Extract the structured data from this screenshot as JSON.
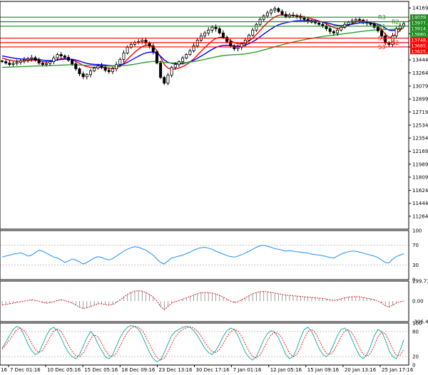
{
  "chart_data": {
    "type": "candlestick",
    "title": "",
    "main": {
      "ylim": [
        11084,
        14260
      ],
      "y_ticks": [
        "14169.0",
        "13989.0",
        "13809.0",
        "13624.0",
        "13444.0",
        "13264.0",
        "13079.0",
        "12899.0",
        "12719.0",
        "12534.0",
        "12354.0",
        "12169.0",
        "11989.0",
        "11809.0",
        "11624.0",
        "11444.0",
        "11264.0"
      ],
      "x_labels": [
        "7 Dec 01:16",
        "10 Dec 05:16",
        "15 Dec 05:16",
        "18 Dec 09:16",
        "23 Dec 13:16",
        "30 Dec 17:16",
        "7 Jan 01:16",
        "12 Jan 05:16",
        "15 Jan 09:16",
        "20 Jan 13:16",
        "25 Jan 17:16"
      ],
      "x_label_left_fragment": "16",
      "candles_close": [
        13420,
        13400,
        13380,
        13395,
        13410,
        13430,
        13445,
        13460,
        13475,
        13440,
        13400,
        13380,
        13395,
        13420,
        13470,
        13520,
        13500,
        13480,
        13440,
        13390,
        13320,
        13250,
        13210,
        13240,
        13290,
        13330,
        13360,
        13340,
        13300,
        13280,
        13320,
        13380,
        13450,
        13540,
        13620,
        13660,
        13690,
        13700,
        13720,
        13680,
        13640,
        13560,
        13400,
        13200,
        13120,
        13230,
        13340,
        13380,
        13420,
        13470,
        13520,
        13570,
        13640,
        13720,
        13780,
        13820,
        13860,
        13900,
        13880,
        13820,
        13760,
        13700,
        13640,
        13600,
        13620,
        13670,
        13720,
        13790,
        13860,
        13940,
        14010,
        14060,
        14100,
        14140,
        14160,
        14120,
        14080,
        14050,
        14070,
        14060,
        14050,
        14030,
        14010,
        13990,
        13970,
        13960,
        13940,
        13920,
        13880,
        13840,
        13820,
        13860,
        13900,
        13940,
        13970,
        13990,
        14010,
        14000,
        13980,
        13960,
        13940,
        13900,
        13850,
        13780,
        13680,
        13660,
        13780,
        13880,
        13920,
        13950
      ],
      "series": [
        {
          "name": "",
          "color": "#ff0000",
          "values": [
            13470,
            13455,
            13440,
            13430,
            13425,
            13425,
            13428,
            13433,
            13440,
            13440,
            13432,
            13420,
            13415,
            13417,
            13430,
            13448,
            13460,
            13465,
            13460,
            13446,
            13425,
            13397,
            13368,
            13350,
            13340,
            13338,
            13340,
            13340,
            13335,
            13328,
            13325,
            13334,
            13357,
            13397,
            13452,
            13505,
            13552,
            13594,
            13630,
            13650,
            13650,
            13628,
            13573,
            13479,
            13380,
            13328,
            13316,
            13319,
            13331,
            13351,
            13379,
            13413,
            13458,
            13511,
            13565,
            13616,
            13664,
            13710,
            13745,
            13760,
            13758,
            13741,
            13714,
            13684,
            13668,
            13668,
            13681,
            13708,
            13747,
            13798,
            13856,
            13912,
            13963,
            14008,
            14044,
            14066,
            14072,
            14066,
            14066,
            14064,
            14061,
            14055,
            14045,
            14032,
            14018,
            14003,
            13987,
            13969,
            13947,
            13921,
            13896,
            13885,
            13888,
            13904,
            13926,
            13951,
            13977,
            13988,
            13986,
            13977,
            13963,
            13941,
            13911,
            13867,
            13804,
            13759,
            13770,
            13812,
            13857,
            13899
          ]
        },
        {
          "name": "",
          "color": "#0000ff",
          "values": [
            13500,
            13490,
            13480,
            13470,
            13463,
            13458,
            13455,
            13454,
            13455,
            13455,
            13450,
            13442,
            13436,
            13433,
            13436,
            13444,
            13451,
            13456,
            13457,
            13453,
            13443,
            13428,
            13410,
            13396,
            13387,
            13382,
            13380,
            13377,
            13372,
            13366,
            13363,
            13364,
            13371,
            13386,
            13411,
            13439,
            13468,
            13496,
            13522,
            13541,
            13552,
            13553,
            13537,
            13496,
            13443,
            13411,
            13397,
            13391,
            13390,
            13394,
            13404,
            13419,
            13440,
            13467,
            13497,
            13528,
            13560,
            13591,
            13618,
            13636,
            13646,
            13649,
            13646,
            13639,
            13636,
            13640,
            13651,
            13670,
            13696,
            13729,
            13767,
            13805,
            13841,
            13876,
            13908,
            13933,
            13950,
            13962,
            13974,
            13983,
            13990,
            13993,
            13994,
            13993,
            13990,
            13986,
            13981,
            13974,
            13963,
            13949,
            13935,
            13927,
            13924,
            13926,
            13933,
            13942,
            13953,
            13960,
            13963,
            13963,
            13960,
            13953,
            13942,
            13922,
            13888,
            13859,
            13853,
            13863,
            13878,
            13894
          ]
        },
        {
          "name": "",
          "color": "#2ca02c",
          "values": [
            13340,
            13342,
            13344,
            13346,
            13348,
            13350,
            13352,
            13355,
            13358,
            13360,
            13361,
            13362,
            13363,
            13364,
            13366,
            13369,
            13372,
            13374,
            13376,
            13377,
            13376,
            13374,
            13371,
            13368,
            13366,
            13364,
            13363,
            13362,
            13360,
            13359,
            13358,
            13358,
            13360,
            13364,
            13370,
            13377,
            13385,
            13394,
            13403,
            13411,
            13418,
            13423,
            13423,
            13418,
            13409,
            13404,
            13402,
            13401,
            13402,
            13404,
            13408,
            13414,
            13421,
            13430,
            13441,
            13452,
            13464,
            13476,
            13487,
            13496,
            13504,
            13510,
            13514,
            13517,
            13520,
            13524,
            13529,
            13536,
            13545,
            13556,
            13569,
            13583,
            13597,
            13612,
            13627,
            13641,
            13655,
            13668,
            13681,
            13693,
            13705,
            13716,
            13726,
            13736,
            13745,
            13754,
            13763,
            13771,
            13778,
            13785,
            13791,
            13797,
            13803,
            13810,
            13817,
            13824,
            13831,
            13838,
            13844,
            13850,
            13856,
            13861,
            13865,
            13868,
            13868,
            13868,
            13871,
            13876,
            13882,
            13888
          ]
        }
      ],
      "levels": [
        {
          "label": "R3",
          "value": 14039.6,
          "color": "#1a8a1a"
        },
        {
          "label": "R2",
          "value": 13977.2,
          "color": "#1a8a1a"
        },
        {
          "label": "R1",
          "value": 13914.7,
          "color": "#1a8a1a"
        },
        {
          "label": "S1",
          "value": 13748.3,
          "color": "#ff0000"
        },
        {
          "label": "S2",
          "value": 13685.8,
          "color": "#ff0000"
        },
        {
          "label": "S3",
          "value": 13625.4,
          "color": "#ff0000"
        }
      ],
      "price_badges": [
        {
          "text": "14039.6",
          "value": 14039.6,
          "color": "#1a8a1a"
        },
        {
          "text": "13977.2",
          "value": 13977.2,
          "color": "#1a8a1a"
        },
        {
          "text": "13914.7",
          "value": 13914.7,
          "color": "#1a8a1a"
        },
        {
          "text": "13880.4",
          "value": 13880.4,
          "color": "#1a8a1a"
        },
        {
          "text": "13748.3",
          "value": 13748.3,
          "color": "#ff0000"
        },
        {
          "text": "13685.8",
          "value": 13685.8,
          "color": "#ff0000"
        },
        {
          "text": "13625.4",
          "value": 13625.4,
          "color": "#ff0000"
        }
      ]
    },
    "rsi": {
      "ylim": [
        0,
        100
      ],
      "y_ticks": [
        "100",
        "70",
        "30",
        "0"
      ],
      "color": "#1e90ff",
      "values": [
        46,
        48,
        50,
        52,
        53,
        55,
        52,
        48,
        50,
        55,
        60,
        58,
        54,
        50,
        46,
        44,
        40,
        35,
        38,
        42,
        40,
        36,
        32,
        35,
        40,
        44,
        47,
        45,
        42,
        40,
        43,
        48,
        53,
        58,
        62,
        65,
        67,
        66,
        63,
        60,
        55,
        50,
        42,
        35,
        32,
        38,
        44,
        46,
        48,
        50,
        53,
        56,
        60,
        63,
        65,
        66,
        64,
        62,
        58,
        55,
        52,
        49,
        47,
        46,
        48,
        51,
        54,
        58,
        62,
        66,
        69,
        70,
        68,
        66,
        63,
        62,
        60,
        58,
        59,
        58,
        57,
        56,
        55,
        54,
        52,
        51,
        50,
        49,
        47,
        45,
        44,
        48,
        52,
        55,
        57,
        58,
        58,
        56,
        54,
        52,
        50,
        48,
        45,
        40,
        35,
        34,
        42,
        47,
        50,
        53
      ]
    },
    "cci": {
      "ylim": [
        -306.45,
        299.71
      ],
      "y_ticks": [
        "299.71",
        "0.00",
        "-306.45"
      ],
      "line_color": "#cc0000",
      "hist_color": "#888888",
      "values": [
        -60,
        -50,
        -40,
        -30,
        -20,
        -10,
        0,
        10,
        20,
        10,
        0,
        -20,
        -30,
        -25,
        -10,
        10,
        20,
        10,
        -10,
        -30,
        -60,
        -90,
        -110,
        -100,
        -80,
        -60,
        -40,
        -40,
        -50,
        -60,
        -50,
        -20,
        20,
        60,
        100,
        130,
        150,
        155,
        150,
        130,
        100,
        60,
        0,
        -80,
        -130,
        -80,
        -30,
        -10,
        10,
        30,
        50,
        70,
        90,
        110,
        125,
        130,
        128,
        120,
        105,
        85,
        60,
        30,
        0,
        -20,
        -10,
        20,
        50,
        80,
        110,
        130,
        140,
        145,
        140,
        130,
        120,
        110,
        100,
        90,
        85,
        80,
        75,
        70,
        65,
        60,
        55,
        50,
        45,
        40,
        30,
        20,
        10,
        20,
        35,
        50,
        60,
        65,
        68,
        65,
        55,
        45,
        35,
        20,
        0,
        -30,
        -70,
        -90,
        -60,
        -30,
        -10,
        0
      ]
    },
    "stochastic": {
      "ylim": [
        0,
        100
      ],
      "y_ticks": [
        "100",
        "80",
        "20",
        "0"
      ],
      "k_color": "#20b2aa",
      "d_color": "#ff0000",
      "k_values": [
        40,
        55,
        70,
        85,
        92,
        88,
        70,
        50,
        35,
        25,
        30,
        50,
        70,
        85,
        90,
        82,
        65,
        45,
        30,
        20,
        15,
        25,
        45,
        65,
        80,
        70,
        50,
        35,
        20,
        15,
        25,
        45,
        65,
        80,
        90,
        94,
        92,
        85,
        70,
        50,
        30,
        15,
        8,
        12,
        30,
        50,
        70,
        80,
        85,
        90,
        92,
        90,
        82,
        70,
        55,
        40,
        30,
        25,
        35,
        50,
        68,
        82,
        88,
        85,
        70,
        50,
        30,
        18,
        12,
        20,
        40,
        60,
        75,
        82,
        78,
        65,
        45,
        25,
        15,
        20,
        40,
        65,
        85,
        90,
        80,
        60,
        40,
        25,
        20,
        30,
        50,
        70,
        85,
        88,
        80,
        60,
        40,
        22,
        15,
        25,
        45,
        70,
        85,
        80,
        60,
        35,
        20,
        15,
        35,
        60
      ],
      "d_values": [
        38,
        48,
        60,
        72,
        85,
        88,
        82,
        68,
        52,
        37,
        30,
        35,
        50,
        67,
        81,
        86,
        80,
        65,
        47,
        32,
        22,
        20,
        28,
        45,
        63,
        72,
        67,
        52,
        35,
        23,
        20,
        28,
        45,
        63,
        78,
        88,
        92,
        90,
        82,
        68,
        50,
        32,
        18,
        12,
        17,
        31,
        50,
        67,
        78,
        85,
        89,
        91,
        88,
        81,
        69,
        55,
        42,
        32,
        30,
        37,
        51,
        67,
        79,
        85,
        81,
        69,
        50,
        33,
        20,
        17,
        24,
        40,
        58,
        72,
        78,
        75,
        63,
        45,
        28,
        20,
        25,
        42,
        63,
        80,
        85,
        77,
        60,
        42,
        28,
        25,
        33,
        50,
        68,
        81,
        84,
        76,
        60,
        41,
        26,
        21,
        28,
        47,
        67,
        78,
        75,
        58,
        38,
        23,
        23,
        37
      ]
    }
  }
}
